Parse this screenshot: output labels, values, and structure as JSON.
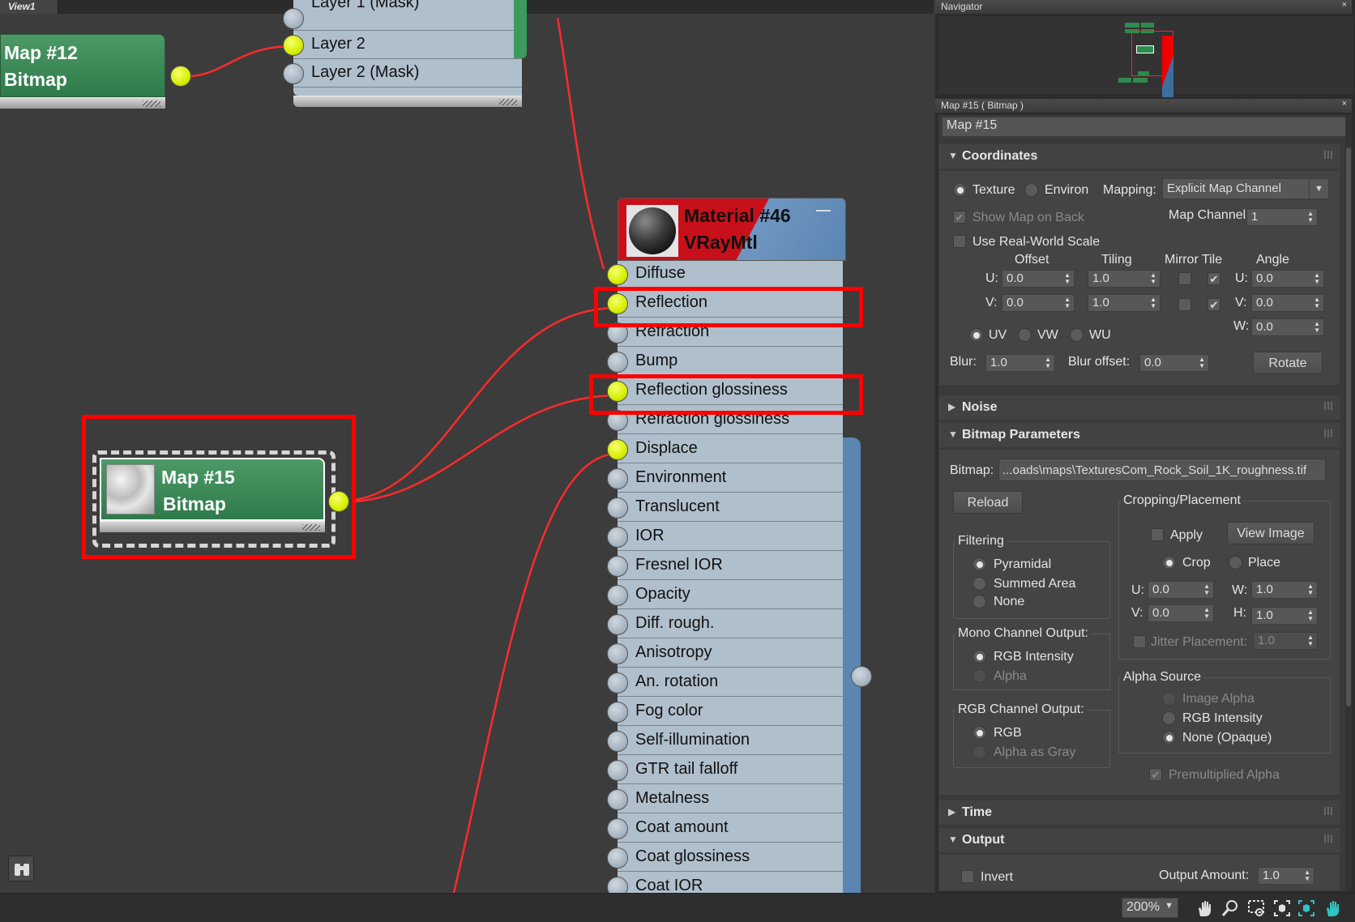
{
  "view": {
    "tab_label": "View1",
    "nodes": {
      "map12": {
        "title": "Map #12",
        "subtitle": "Bitmap"
      },
      "layer": {
        "slots": [
          "Layer 1 (Mask)",
          "Layer 2",
          "Layer 2 (Mask)"
        ]
      },
      "map15": {
        "title": "Map #15",
        "subtitle": "Bitmap"
      },
      "material": {
        "title": "Material #46",
        "subtitle": "VRayMtl",
        "collapse_symbol": "—",
        "slots": [
          {
            "label": "Diffuse",
            "connected": true
          },
          {
            "label": "Reflection",
            "connected": true
          },
          {
            "label": "Refraction",
            "connected": false
          },
          {
            "label": "Bump",
            "connected": false
          },
          {
            "label": "Reflection glossiness",
            "connected": true
          },
          {
            "label": "Refraction glossiness",
            "connected": false
          },
          {
            "label": "Displace",
            "connected": true
          },
          {
            "label": "Environment",
            "connected": false
          },
          {
            "label": "Translucent",
            "connected": false
          },
          {
            "label": "IOR",
            "connected": false
          },
          {
            "label": "Fresnel IOR",
            "connected": false
          },
          {
            "label": "Opacity",
            "connected": false
          },
          {
            "label": "Diff. rough.",
            "connected": false
          },
          {
            "label": "Anisotropy",
            "connected": false
          },
          {
            "label": "An. rotation",
            "connected": false
          },
          {
            "label": "Fog color",
            "connected": false
          },
          {
            "label": "Self-illumination",
            "connected": false
          },
          {
            "label": "GTR tail falloff",
            "connected": false
          },
          {
            "label": "Metalness",
            "connected": false
          },
          {
            "label": "Coat amount",
            "connected": false
          },
          {
            "label": "Coat glossiness",
            "connected": false
          },
          {
            "label": "Coat IOR",
            "connected": false
          }
        ]
      }
    },
    "icons": {
      "binoculars": "binoculars-icon"
    }
  },
  "colors": {
    "wire": "#ff2a2a",
    "highlight": "#ff0000",
    "bitmap_header": "#3f8a58",
    "port_on": "#d9f200",
    "port_off": "#a9b7c4",
    "node_body": "#b0bfcc",
    "material_header_red": "#c8101a",
    "material_header_blue": "#6e96c0"
  },
  "navigator": {
    "title": "Navigator",
    "close": "×"
  },
  "params": {
    "header": "Map #15  ( Bitmap )",
    "close": "×",
    "name_field": "Map #15",
    "rollouts": {
      "coordinates": {
        "title": "Coordinates",
        "texture": "Texture",
        "environ": "Environ",
        "mapping_label": "Mapping:",
        "mapping_value": "Explicit Map Channel",
        "show_map_on_back": "Show Map on Back",
        "map_channel_label": "Map Channel:",
        "map_channel_value": "1",
        "use_real_world": "Use Real-World Scale",
        "col_offset": "Offset",
        "col_tiling": "Tiling",
        "col_mirror_tile": "Mirror Tile",
        "col_angle": "Angle",
        "u_label": "U:",
        "v_label": "V:",
        "w_label": "W:",
        "offset_u": "0.0",
        "offset_v": "0.0",
        "tiling_u": "1.0",
        "tiling_v": "1.0",
        "angle_u": "0.0",
        "angle_v": "0.0",
        "angle_w": "0.0",
        "uv": "UV",
        "vw": "VW",
        "wu": "WU",
        "blur_label": "Blur:",
        "blur_value": "1.0",
        "blur_offset_label": "Blur offset:",
        "blur_offset_value": "0.0",
        "rotate": "Rotate",
        "check": "✔"
      },
      "noise": {
        "title": "Noise"
      },
      "bitmap_params": {
        "title": "Bitmap Parameters",
        "bitmap_label": "Bitmap:",
        "bitmap_path": "...oads\\maps\\TexturesCom_Rock_Soil_1K_roughness.tif",
        "reload": "Reload",
        "cropping": "Cropping/Placement",
        "apply": "Apply",
        "view_image": "View Image",
        "crop": "Crop",
        "place": "Place",
        "u_label": "U:",
        "v_label": "V:",
        "w_label": "W:",
        "h_label": "H:",
        "crop_u": "0.0",
        "crop_v": "0.0",
        "crop_w": "1.0",
        "crop_h": "1.0",
        "jitter": "Jitter Placement:",
        "jitter_value": "1.0",
        "filtering": "Filtering",
        "pyramidal": "Pyramidal",
        "summed_area": "Summed Area",
        "none": "None",
        "mono_output": "Mono Channel Output:",
        "rgb_intensity": "RGB Intensity",
        "alpha": "Alpha",
        "alpha_source": "Alpha Source",
        "image_alpha": "Image Alpha",
        "alpha_rgb_intensity": "RGB Intensity",
        "none_opaque": "None (Opaque)",
        "rgb_output": "RGB Channel Output:",
        "rgb": "RGB",
        "alpha_as_gray": "Alpha as Gray",
        "premultiplied": "Premultiplied Alpha",
        "check": "✔"
      },
      "time": {
        "title": "Time"
      },
      "output": {
        "title": "Output",
        "invert": "Invert",
        "output_amount_label": "Output Amount:",
        "output_amount_value": "1.0"
      }
    }
  },
  "status": {
    "zoom": "200%",
    "icons": [
      "pan-hand-icon",
      "zoom-icon",
      "zoom-region-icon",
      "frame-all-icon",
      "frame-selected-icon",
      "pan-to-selected-icon"
    ]
  }
}
